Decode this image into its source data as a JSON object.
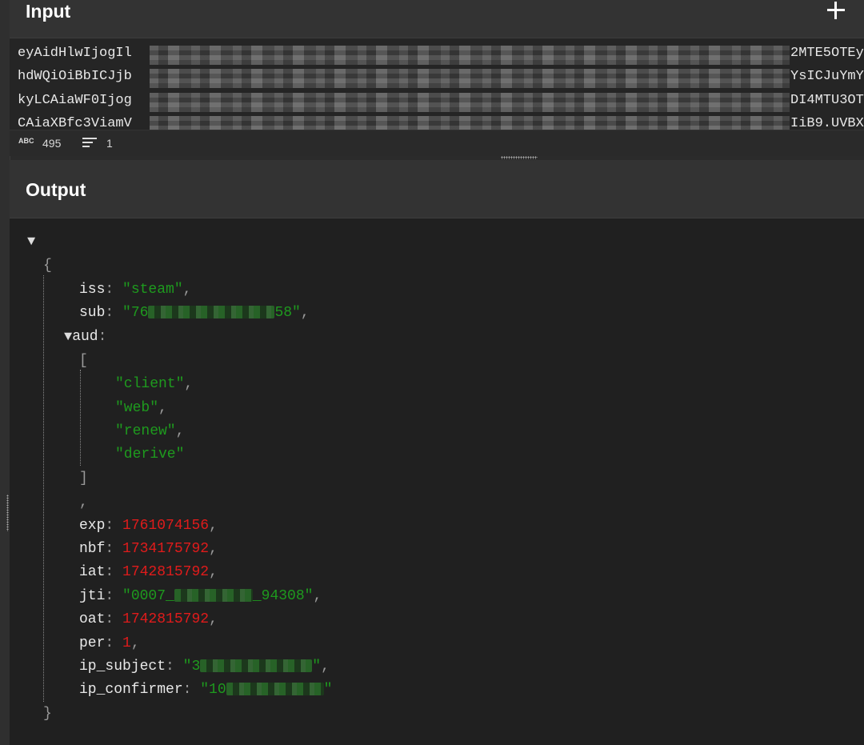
{
  "input": {
    "title": "Input",
    "add_icon": "plus-icon",
    "lines": [
      {
        "head": "eyAidHlwIjogIl",
        "tail": "2MTE5OTEy"
      },
      {
        "head": "hdWQiOiBbICJjb",
        "tail": "YsICJuYmY"
      },
      {
        "head": "kyLCAiaWF0Ijog",
        "tail": "DI4MTU3OT"
      },
      {
        "head": "CAiaXBfc3ViamV",
        "tail": "IiB9.UVBX"
      }
    ],
    "status": {
      "char_icon": "abc-icon",
      "char_icon_text": "ABC",
      "char_count": "495",
      "lines_icon": "lines-icon",
      "line_count": "1"
    }
  },
  "output": {
    "title": "Output",
    "json": {
      "root_toggle": "▼",
      "open_brace": "{",
      "close_brace": "}",
      "fields": {
        "iss": {
          "key": "iss",
          "value": "\"steam\""
        },
        "sub": {
          "key": "sub",
          "value_start": "\"76",
          "value_end": "58\""
        },
        "aud": {
          "key": "aud",
          "toggle": "▼",
          "open_bracket": "[",
          "close_bracket": "]",
          "items": [
            "\"client\"",
            "\"web\"",
            "\"renew\"",
            "\"derive\""
          ],
          "trailing_comma": ","
        },
        "exp": {
          "key": "exp",
          "value": "1761074156"
        },
        "nbf": {
          "key": "nbf",
          "value": "1734175792"
        },
        "iat": {
          "key": "iat",
          "value": "1742815792"
        },
        "jti": {
          "key": "jti",
          "value_start": "\"0007_",
          "value_end": "_94308\""
        },
        "oat": {
          "key": "oat",
          "value": "1742815792"
        },
        "per": {
          "key": "per",
          "value": "1"
        },
        "ip_subject": {
          "key": "ip_subject",
          "value_start": "\"3",
          "value_end": "\""
        },
        "ip_confirmer": {
          "key": "ip_confirmer",
          "value_start": "\"10",
          "value_end": "\""
        }
      },
      "colon": ":",
      "comma": ","
    }
  },
  "colors": {
    "string": "#1e9a1e",
    "number": "#e01b1b",
    "key": "#e8e8e8",
    "background": "#202020"
  }
}
